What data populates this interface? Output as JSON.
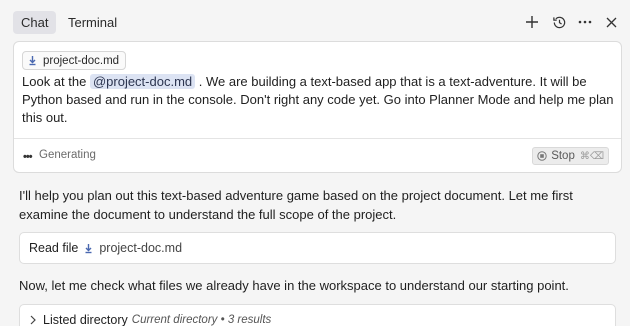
{
  "header": {
    "tabs": [
      {
        "label": "Chat",
        "active": true
      },
      {
        "label": "Terminal",
        "active": false
      }
    ],
    "icons": [
      "plus-icon",
      "history-icon",
      "more-icon",
      "close-icon"
    ]
  },
  "composer": {
    "attachment": "project-doc.md",
    "prompt_before": "Look at the ",
    "mention": "@project-doc.md",
    "prompt_after": " .  We are building a text-based app that is a text-adventure.  It will be Python based and run in the console.  Don't right any code yet.  Go into Planner Mode and help me plan this out.",
    "status_dots": "•••",
    "status": "Generating",
    "stop_label": "Stop",
    "stop_shortcut": "⌘⌫"
  },
  "conversation": {
    "msg1": "I'll help you plan out this text-based adventure game based on the project document. Let me first examine the document to understand the full scope of the project.",
    "tool1": {
      "verb": "Read file",
      "file": "project-doc.md"
    },
    "msg2": "Now, let me check what files we already have in the workspace to understand our starting point.",
    "tool2": {
      "verb": "Listed directory",
      "detail": "Current directory • 3 results"
    }
  }
}
